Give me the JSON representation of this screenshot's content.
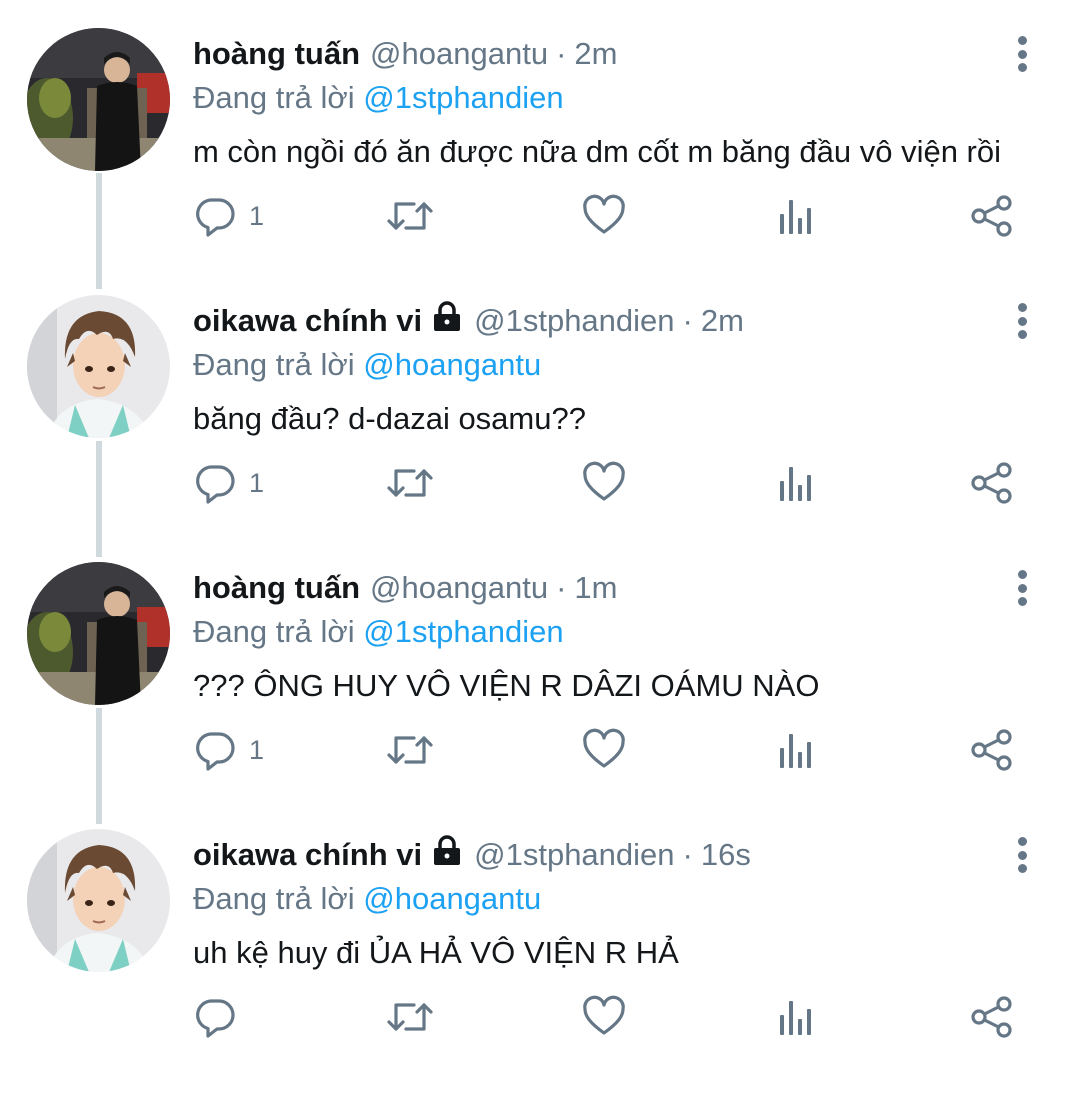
{
  "colors": {
    "accent": "#1da1f2",
    "muted": "#657786",
    "thread_line": "#cfd9de",
    "text": "#14171a"
  },
  "tweets": [
    {
      "name": "hoàng tuấn",
      "protected": false,
      "handle": "@hoangantu",
      "dot": "·",
      "time": "2m",
      "reply_prefix": "Đang trả lời",
      "reply_to": "@1stphandien",
      "text": "m còn ngồi đó ăn được nữa dm cốt m băng đầu vô viện rồi",
      "reply_count": "1",
      "avatar": "photo-avatar"
    },
    {
      "name": "oikawa chính vi",
      "protected": true,
      "handle": "@1stphandien",
      "dot": "·",
      "time": "2m",
      "reply_prefix": "Đang trả lời",
      "reply_to": "@hoangantu",
      "text": "băng đầu? d-dazai osamu??",
      "reply_count": "1",
      "avatar": "anime-avatar"
    },
    {
      "name": "hoàng tuấn",
      "protected": false,
      "handle": "@hoangantu",
      "dot": "·",
      "time": "1m",
      "reply_prefix": "Đang trả lời",
      "reply_to": "@1stphandien",
      "text": "??? ÔNG HUY VÔ VIỆN R DÂZI OÁMU NÀO",
      "reply_count": "1",
      "avatar": "photo-avatar"
    },
    {
      "name": "oikawa chính vi",
      "protected": true,
      "handle": "@1stphandien",
      "dot": "·",
      "time": "16s",
      "reply_prefix": "Đang trả lời",
      "reply_to": "@hoangantu",
      "text": "uh kệ huy đi ỦA HẢ VÔ VIỆN R HẢ",
      "reply_count": "",
      "avatar": "anime-avatar"
    }
  ]
}
